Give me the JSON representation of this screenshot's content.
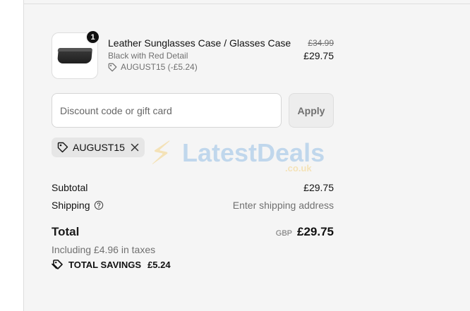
{
  "line_item": {
    "quantity": "1",
    "name": "Leather Sunglasses Case / Glasses Case",
    "variant": "Black with Red Detail",
    "discount": "AUGUST15 (-£5.24)",
    "original_price": "£34.99",
    "price": "£29.75"
  },
  "discount_form": {
    "placeholder": "Discount code or gift card",
    "value": "",
    "apply_label": "Apply"
  },
  "applied_code": {
    "code": "AUGUST15"
  },
  "watermark": {
    "text": "LatestDeals",
    "subtext": ".co.uk"
  },
  "summary": {
    "subtotal_label": "Subtotal",
    "subtotal_value": "£29.75",
    "shipping_label": "Shipping",
    "shipping_value": "Enter shipping address",
    "total_label": "Total",
    "currency": "GBP",
    "total_value": "£29.75",
    "tax_note": "Including £4.96 in taxes",
    "savings_label": "TOTAL SAVINGS",
    "savings_value": "£5.24"
  },
  "icons": {
    "tag": "tag-icon",
    "close": "close-icon",
    "help": "help-circle-icon",
    "savings": "savings-tag-icon"
  },
  "colors": {
    "panel_background": "#f5f5f5",
    "text": "#111111",
    "muted_text": "#707070",
    "chip_background": "#e6e6e6"
  }
}
